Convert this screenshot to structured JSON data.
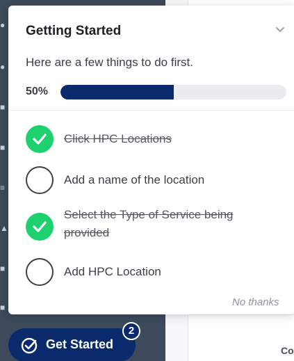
{
  "checklist": {
    "title": "Getting Started",
    "subtitle": "Here are a few things to do first.",
    "progress_label": "50%",
    "progress_fraction": 0.5,
    "tasks": [
      {
        "label": "Click HPC Locations",
        "done": true
      },
      {
        "label": "Add a name of the location",
        "done": false
      },
      {
        "label": "Select the Type of Service being provided",
        "done": true
      },
      {
        "label": "Add HPC Location",
        "done": false
      }
    ],
    "dismiss_label": "No thanks"
  },
  "launcher": {
    "label": "Get Started",
    "badge_count": "2",
    "icon": "check-circle-icon"
  },
  "background": {
    "panel_text": "Co"
  },
  "colors": {
    "brand_navy": "#0b2a6b",
    "done_green": "#1fd06f",
    "sidebar": "#3d4a5b"
  }
}
